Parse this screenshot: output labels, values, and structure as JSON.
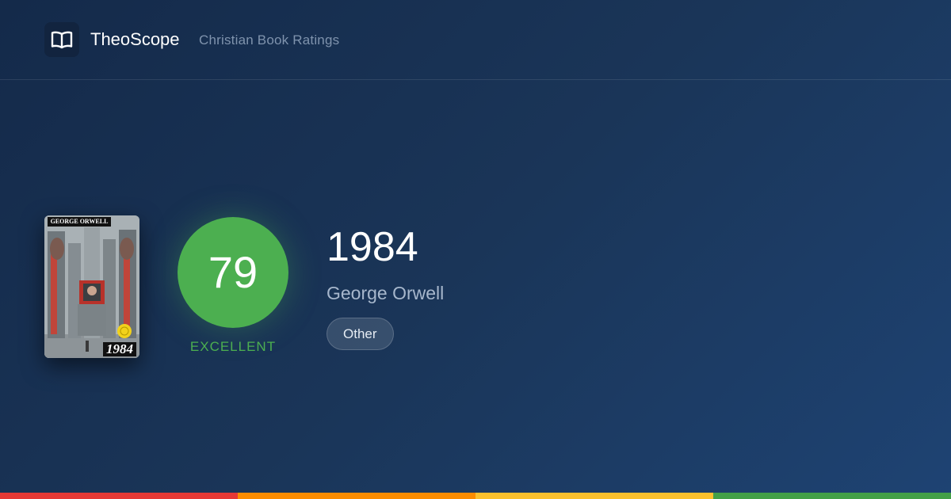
{
  "header": {
    "brand": "TheoScope",
    "tagline": "Christian Book Ratings",
    "logo_icon": "open-book-icon"
  },
  "book": {
    "title": "1984",
    "author": "George Orwell",
    "genre": "Other",
    "cover": {
      "author_text": "GEORGE ORWELL",
      "title_text": "1984"
    }
  },
  "score": {
    "value": "79",
    "label": "EXCELLENT",
    "color": "#4caf50"
  },
  "rating_scale_colors": [
    "#e53935",
    "#fb8c00",
    "#fbc02d",
    "#43a047"
  ]
}
